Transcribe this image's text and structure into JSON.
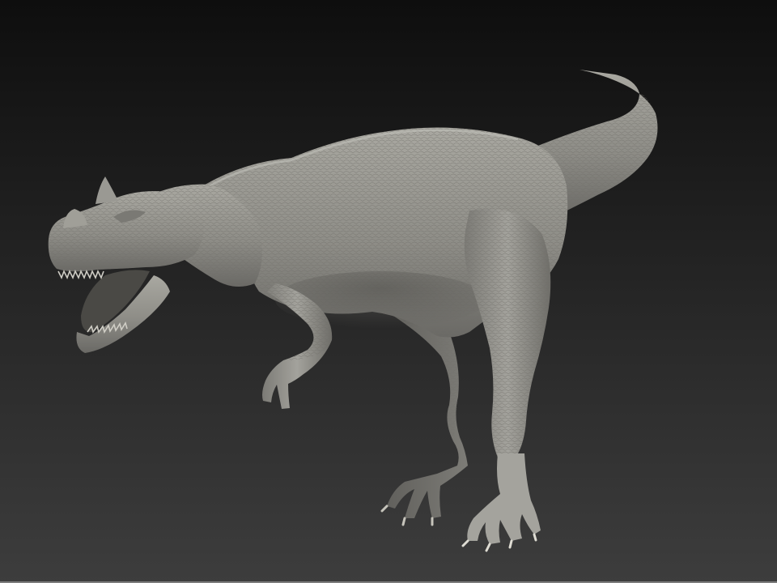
{
  "viewport": {
    "background_top": "#0e0e0e",
    "background_bottom": "#3d3d3d",
    "edge_line": "#7d7d7d"
  },
  "model": {
    "subject": "dinosaur-sculpt",
    "material_base": "#908f89",
    "material_light": "#b6b5ae",
    "material_shadow": "#5a5955"
  }
}
